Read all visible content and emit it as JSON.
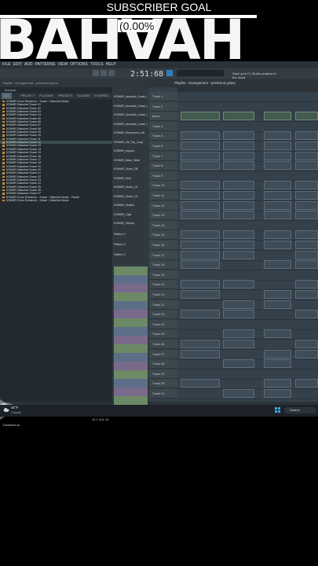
{
  "overlay": {
    "goal_title": "SUBSCRIBER GOAL",
    "goal_percent": "(0.00%",
    "big_word": "BAHVAH"
  },
  "app": {
    "menu": [
      "FILE",
      "EDIT",
      "ADD",
      "PATTERNS",
      "VIEW",
      "OPTIONS",
      "TOOLS",
      "HELP"
    ],
    "tempo": "2:51:68",
    "hint": "Playlist · Arrangement · preshonic piano",
    "cloud_hint": "Save your FL Studio projects to the cloud",
    "pattern_name": "preshc piano"
  },
  "browser": {
    "header": "Browser",
    "tabs": [
      "ALL",
      "PROJECT",
      "PLUGINS",
      "PRESETS",
      "SOUNDS",
      "STARRED"
    ],
    "items": [
      "KSHMR Drum Enhancer - Snare - Distorted Noise",
      "KSHMR Distorted Snare 01",
      "KSHMR Distorted Snare 02",
      "KSHMR Distorted Snare 03",
      "KSHMR Distorted Snare 04",
      "KSHMR Distorted Snare 05",
      "KSHMR Distorted Snare 06",
      "KSHMR Distorted Snare 07",
      "KSHMR Distorted Snare 08",
      "KSHMR Distorted Snare 09",
      "KSHMR Distorted Snare 10",
      "KSHMR Distorted Snare 11",
      "KSHMR Distorted Snare 12",
      "KSHMR Distorted Snare 13",
      "KSHMR Distorted Snare 14",
      "KSHMR Distorted Snare 15",
      "KSHMR Distorted Snare 16",
      "KSHMR Distorted Snare 17",
      "KSHMR Distorted Snare 18",
      "KSHMR Distorted Snare 19",
      "KSHMR Distorted Snare 20",
      "KSHMR Distorted Snare 21",
      "KSHMR Distorted Snare 22",
      "KSHMR Distorted Snare 23",
      "KSHMR Distorted Snare 24",
      "KSHMR Distorted Snare 25",
      "KSHMR Distorted Snare 26",
      "KSHMR Distorted Snare 27",
      "KSHMR Drum Enhancer - Snare - Distorted Noise - Flame",
      "KSHMR Drum Enhancer - Snare - Distorted Noise"
    ],
    "selected_index": 12,
    "wave_label": "Distorted sn",
    "wave_info": "44.1 kHz 16"
  },
  "rack": {
    "channels": [
      "KSHMR_Acoustic_Crash_01",
      "KSHMR_Acoustic_Crash_02",
      "KSHMR_Acoustic_Crash_03",
      "KSHMR_Acoustic_Crash_04",
      "KSHMR_Percussion_Hit",
      "KSHMR_Hit_Top_Loop",
      "KSHMR_Impact",
      "KSHMR_Bass_Slide",
      "KSHMR_Drum_Fill",
      "KSHMR_Kick",
      "KSHMR_Snare_01",
      "KSHMR_Snare_02",
      "KSHMR_Shaker",
      "KSHMR_Clap",
      "KSHMR_Sweep",
      "Pattern 1",
      "Pattern 2",
      "Pattern 3"
    ]
  },
  "playlist": {
    "title": "Playlist - Arrangement - preshonic piano",
    "tracks": [
      "Track 1",
      "Track 2",
      "piano",
      "Track 4",
      "Track 5",
      "Track 6",
      "Track 7",
      "Track 8",
      "Track 9",
      "Track 10",
      "Track 11",
      "Track 12",
      "Track 13",
      "Track 14",
      "Track 15",
      "Track 16",
      "Track 17",
      "Track 18",
      "Track 19",
      "Track 20",
      "Track 21",
      "Track 22",
      "Track 23",
      "Track 24",
      "Track 25",
      "Track 26",
      "Track 27",
      "Track 28",
      "Track 29",
      "Track 30",
      "Track 31"
    ]
  },
  "taskbar": {
    "temp": "40°F",
    "weather": "Cloudy",
    "search": "Search"
  },
  "colors": {
    "accent": "#c98b34",
    "clip": "#3e4c57",
    "background": "#2b3339"
  }
}
